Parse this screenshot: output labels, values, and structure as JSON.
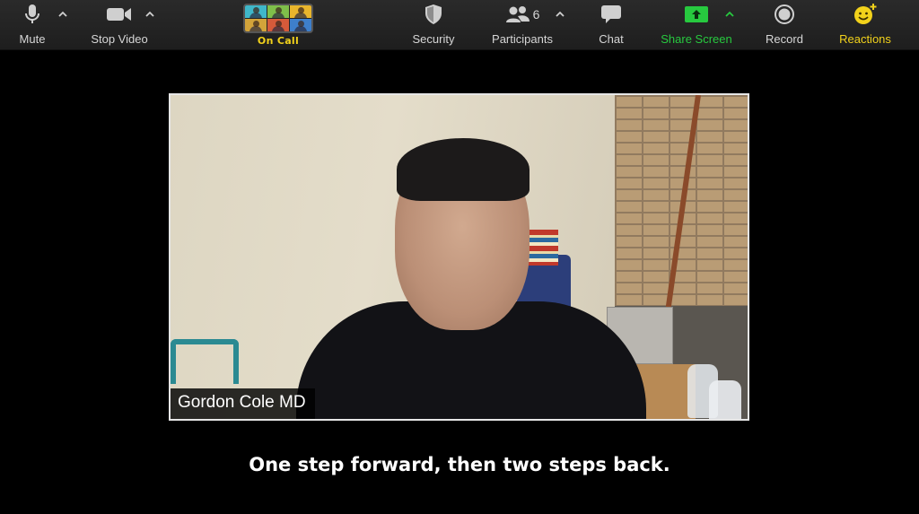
{
  "toolbar": {
    "mute_label": "Mute",
    "stop_video_label": "Stop Video",
    "oncall_label": "On Call",
    "security_label": "Security",
    "participants_label": "Participants",
    "participants_count": "6",
    "chat_label": "Chat",
    "share_screen_label": "Share Screen",
    "record_label": "Record",
    "reactions_label": "Reactions"
  },
  "icons": {
    "mute": "microphone-icon",
    "stop_video": "video-camera-icon",
    "security": "shield-icon",
    "participants": "people-icon",
    "chat": "chat-bubble-icon",
    "share_screen": "share-screen-icon",
    "record": "record-icon",
    "reactions": "smiley-plus-icon",
    "caret": "chevron-up-icon"
  },
  "colors": {
    "share_screen": "#27c93f",
    "reactions": "#f2d21b",
    "oncall": "#f2d21b",
    "toolbar_bg": "#242424"
  },
  "video": {
    "participant_name": "Gordon Cole MD"
  },
  "caption": {
    "text": "One step forward, then two steps back."
  }
}
